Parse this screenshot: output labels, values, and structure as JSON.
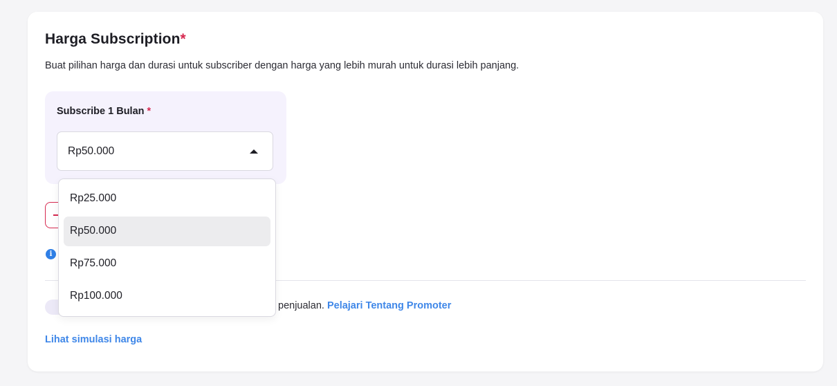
{
  "section": {
    "title": "Harga Subscription",
    "required_mark": "*",
    "description": "Buat pilihan harga dan durasi untuk subscriber dengan harga yang lebih murah untuk durasi lebih panjang."
  },
  "price_option": {
    "label": "Subscribe 1 Bulan",
    "required_mark": "*",
    "selected_value": "Rp50.000",
    "options": [
      "Rp25.000",
      "Rp50.000",
      "Rp75.000",
      "Rp100.000"
    ],
    "highlighted_index": 1
  },
  "promoter": {
    "text_fragment": "penjualan.",
    "link": "Pelajari Tentang Promoter"
  },
  "simulation_link": "Lihat simulasi harga",
  "colors": {
    "accent_red": "#d6284f",
    "link_blue": "#3f87e8",
    "panel_lavender": "#f5f2fd"
  }
}
